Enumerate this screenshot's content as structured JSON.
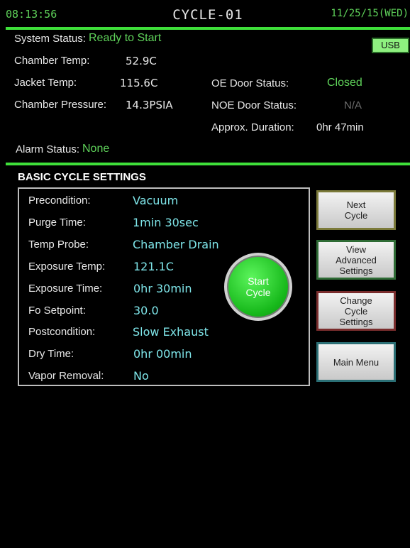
{
  "header": {
    "time": "08:13:56",
    "title": "CYCLE-01",
    "date": "11/25/15(WED)"
  },
  "status": {
    "system_label": "System Status:",
    "system_value": "Ready to Start",
    "usb": "USB",
    "chamber_temp_label": "Chamber Temp:",
    "chamber_temp_value": "52.9C",
    "jacket_temp_label": "Jacket Temp:",
    "jacket_temp_value": "115.6C",
    "chamber_pressure_label": "Chamber Pressure:",
    "chamber_pressure_value": "14.3PSIA",
    "oe_door_label": "OE Door Status:",
    "oe_door_value": "Closed",
    "noe_door_label": "NOE Door Status:",
    "noe_door_value": "N/A",
    "duration_label": "Approx. Duration:",
    "duration_value": "0hr 47min",
    "alarm_label": "Alarm Status:",
    "alarm_value": "None"
  },
  "settings": {
    "title": "BASIC CYCLE SETTINGS",
    "items": [
      {
        "label": "Precondition:",
        "value": "Vacuum"
      },
      {
        "label": "Purge Time:",
        "value": "1min 30sec"
      },
      {
        "label": "Temp Probe:",
        "value": "Chamber Drain"
      },
      {
        "label": "Exposure Temp:",
        "value": "121.1C"
      },
      {
        "label": "Exposure Time:",
        "value": "0hr 30min"
      },
      {
        "label": "Fo Setpoint:",
        "value": "30.0"
      },
      {
        "label": "Postcondition:",
        "value": "Slow Exhaust"
      },
      {
        "label": "Dry Time:",
        "value": "0hr 00min"
      },
      {
        "label": "Vapor Removal:",
        "value": "No"
      }
    ]
  },
  "buttons": {
    "start": "Start Cycle",
    "next": "Next Cycle",
    "advanced": "View Advanced Settings",
    "change": "Change Cycle Settings",
    "menu": "Main Menu"
  },
  "colors": {
    "accent_green": "#3fe03a",
    "status_green": "#5fd35a",
    "value_cyan": "#7fe6ea"
  }
}
